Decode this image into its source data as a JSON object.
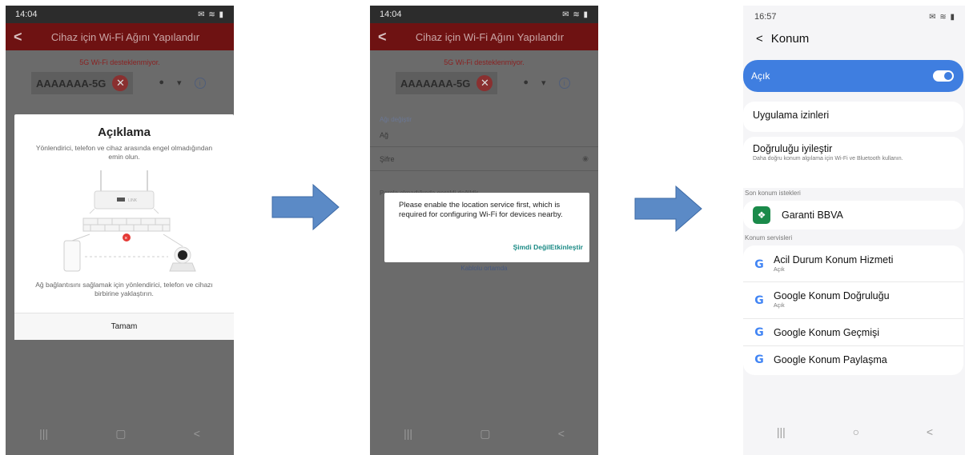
{
  "screen1": {
    "status_time": "14:04",
    "header_title": "Cihaz için Wi-Fi Ağını Yapılandır",
    "warning": "5G Wi-Fi desteklenmiyor.",
    "ssid": "AAAAAAA-5G",
    "dialog": {
      "title": "Açıklama",
      "desc_top": "Yönlendirici, telefon ve cihaz arasında engel olmadığından emin olun.",
      "router_label": "LINK",
      "desc_bottom": "Ağ bağlantısını sağlamak için yönlendirici, telefon ve cihazı birbirine yaklaştırın.",
      "ok_button": "Tamam"
    }
  },
  "screen2": {
    "status_time": "14:04",
    "header_title": "Cihaz için Wi-Fi Ağını Yapılandır",
    "warning": "5G Wi-Fi desteklenmiyor.",
    "ssid": "AAAAAAA-5G",
    "form": {
      "change_network": "Ağı değiştir",
      "network_label": "Ağ",
      "password_label": "Şifre",
      "partial_line": "Parola olmadığında gerekli değildir",
      "partial_link": "Kablolu ortamda"
    },
    "dialog": {
      "message": "Please enable the location service first, which is required for configuring Wi-Fi for devices nearby.",
      "not_now": "Şimdi Değil",
      "enable": "Etkinleştir"
    }
  },
  "screen3": {
    "status_time": "16:57",
    "title": "Konum",
    "toggle_label": "Açık",
    "app_permissions": "Uygulama izinleri",
    "accuracy": {
      "title": "Doğruluğu iyileştir",
      "subtitle": "Daha doğru konum algılama için Wi-Fi ve Bluetooth kullanın."
    },
    "recent_header": "Son konum istekleri",
    "recent_app": "Garanti BBVA",
    "services_header": "Konum servisleri",
    "services": [
      {
        "title": "Acil Durum Konum Hizmeti",
        "subtitle": "Açık"
      },
      {
        "title": "Google Konum Doğruluğu",
        "subtitle": "Açık"
      },
      {
        "title": "Google Konum Geçmişi",
        "subtitle": ""
      },
      {
        "title": "Google Konum Paylaşma",
        "subtitle": ""
      }
    ]
  },
  "colors": {
    "header_red": "#c62828",
    "accent_blue": "#3f7ee0",
    "arrow_blue": "#5b8ac6",
    "teal_action": "#1a8a85"
  },
  "icons": {
    "nav": [
      "recents-icon",
      "home-icon",
      "back-icon"
    ],
    "service": "google-g-icon"
  }
}
